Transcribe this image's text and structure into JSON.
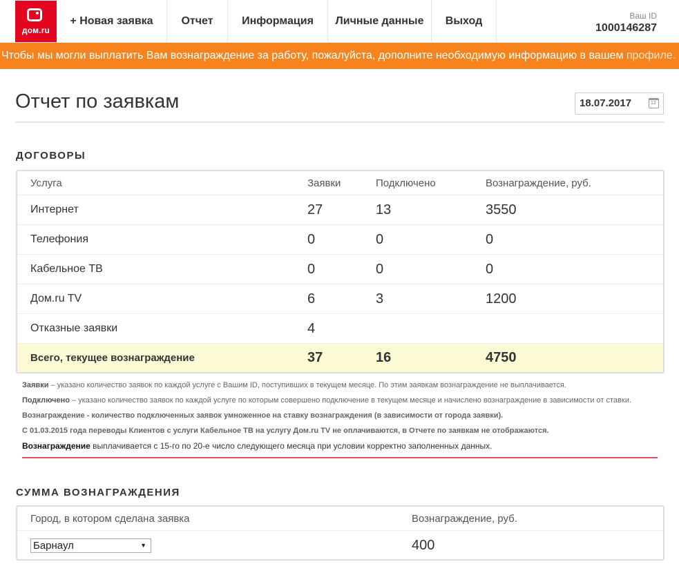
{
  "header": {
    "logo_text": "дом.ru",
    "nav": [
      {
        "label": "+ Новая заявка"
      },
      {
        "label": "Отчет"
      },
      {
        "label": "Информация"
      },
      {
        "label": "Личные данные"
      },
      {
        "label": "Выход"
      }
    ],
    "user_id_label": "Ваш ID",
    "user_id_value": "1000146287"
  },
  "banner": {
    "text": "Чтобы мы могли выплатить Вам вознаграждение за работу, пожалуйста, дополните необходимую информацию в вашем ",
    "link_text": "профиле."
  },
  "page": {
    "title": "Отчет по заявкам",
    "date": "18.07.2017"
  },
  "contracts": {
    "heading": "ДОГОВОРЫ",
    "columns": [
      "Услуга",
      "Заявки",
      "Подключено",
      "Вознаграждение, руб."
    ],
    "rows": [
      {
        "service": "Интернет",
        "requests": "27",
        "connected": "13",
        "reward": "3550"
      },
      {
        "service": "Телефония",
        "requests": "0",
        "connected": "0",
        "reward": "0"
      },
      {
        "service": "Кабельное ТВ",
        "requests": "0",
        "connected": "0",
        "reward": "0"
      },
      {
        "service": "Дом.ru TV",
        "requests": "6",
        "connected": "3",
        "reward": "1200"
      },
      {
        "service": "Отказные заявки",
        "requests": "4",
        "connected": "",
        "reward": ""
      }
    ],
    "total": {
      "service": "Всего, текущее вознаграждение",
      "requests": "37",
      "connected": "16",
      "reward": "4750"
    }
  },
  "notes": [
    {
      "bold": "Заявки",
      "text": " – указано количество заявок по каждой услуге с Вашим ID, поступивших в текущем месяце. По этим заявкам вознаграждение не выплачивается."
    },
    {
      "bold": "Подключено",
      "text": " – указано количество заявок по каждой услуге по которым совершено подключение в текущем месяце и начислено вознаграждение в зависимости от ставки."
    },
    {
      "text": "Вознаграждение - количество подключенных заявок умноженное на ставку вознаграждения (в зависимости от города заявки)."
    },
    {
      "text": "С 01.03.2015 года переводы Клиентов с услуги Кабельное ТВ на услугу Дом.ru TV не оплачиваются, в Отчете по заявкам не отображаются."
    },
    {
      "bold": "Вознаграждение",
      "text": " выплачивается с 15-го по 20-е число следующего месяца при условии корректно заполненных данных."
    }
  ],
  "reward_sum": {
    "heading": "СУММА ВОЗНАГРАЖДЕНИЯ",
    "col_city": "Город, в котором сделана заявка",
    "col_reward": "Вознаграждение, руб.",
    "city_selected": "Барнаул",
    "value": "400"
  }
}
